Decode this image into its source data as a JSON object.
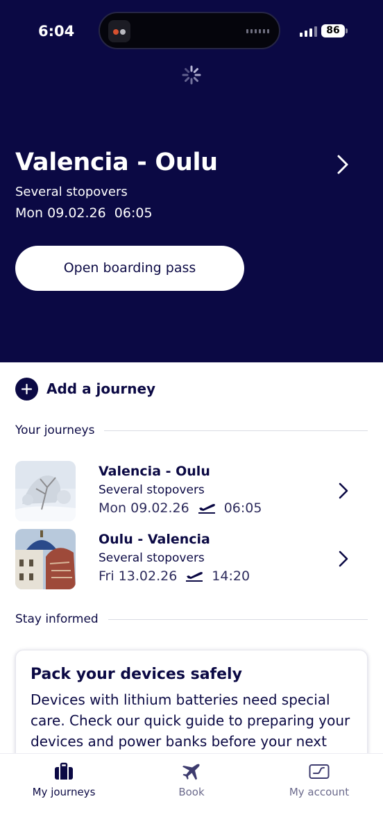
{
  "status_bar": {
    "time": "6:04",
    "battery": "86"
  },
  "hero": {
    "route": "Valencia - Oulu",
    "stops": "Several stopovers",
    "datetime": "Mon 09.02.26  06:05",
    "boarding_button": "Open boarding pass"
  },
  "add_journey": {
    "label": "Add a journey"
  },
  "your_journeys": {
    "heading": "Your journeys",
    "items": [
      {
        "route": "Valencia - Oulu",
        "stops": "Several stopovers",
        "date": "Mon 09.02.26",
        "time": "06:05",
        "image": "snowy-trees"
      },
      {
        "route": "Oulu - Valencia",
        "stops": "Several stopovers",
        "date": "Fri 13.02.26",
        "time": "14:20",
        "image": "valencia-dome"
      }
    ]
  },
  "stay_informed": {
    "heading": "Stay informed",
    "card_title": "Pack your devices safely",
    "card_body": "Devices with lithium batteries need special care. Check our quick guide to preparing your devices and power banks before your next"
  },
  "tabbar": {
    "tabs": [
      {
        "label": "My journeys",
        "icon": "suitcase-icon",
        "active": true
      },
      {
        "label": "Book",
        "icon": "airplane-icon",
        "active": false
      },
      {
        "label": "My account",
        "icon": "boarding-card-icon",
        "active": false
      }
    ]
  },
  "colors": {
    "navy": "#0b0944",
    "white": "#ffffff",
    "inactive": "#6b6a8c"
  }
}
